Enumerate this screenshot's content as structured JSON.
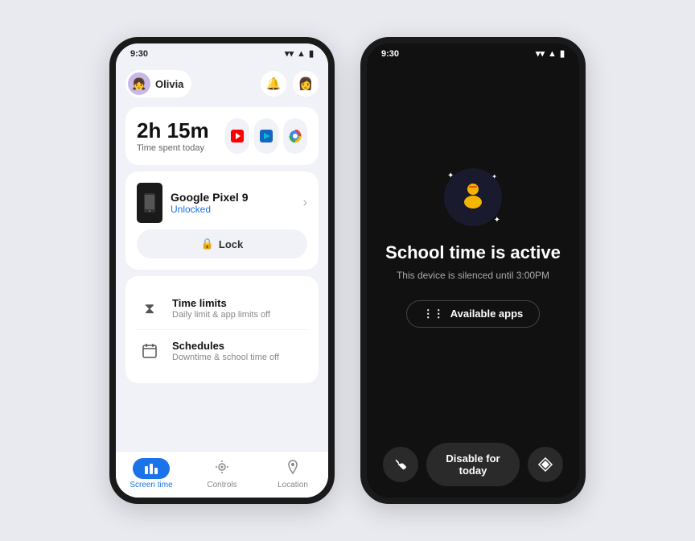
{
  "left_phone": {
    "status_time": "9:30",
    "user_name": "Olivia",
    "time_spent": "2h 15m",
    "time_label": "Time spent today",
    "app_icons": [
      "▶",
      "▷",
      "◉"
    ],
    "device_name": "Google Pixel 9",
    "device_status": "Unlocked",
    "lock_label": "Lock",
    "menu_items": [
      {
        "icon": "⧖",
        "title": "Time limits",
        "subtitle": "Daily limit & app limits off"
      },
      {
        "icon": "📅",
        "title": "Schedules",
        "subtitle": "Downtime & school time off"
      }
    ],
    "nav_items": [
      {
        "label": "Screen time",
        "active": true
      },
      {
        "label": "Controls",
        "active": false
      },
      {
        "label": "Location",
        "active": false
      }
    ]
  },
  "right_phone": {
    "status_time": "9:30",
    "school_icon": "🧑‍🎓",
    "title": "School time is active",
    "subtitle": "This device is silenced until 3:00PM",
    "available_apps_label": "Available apps",
    "disable_label": "Disable for today",
    "phone_icon": "📞",
    "diamond_icon": "◈"
  }
}
